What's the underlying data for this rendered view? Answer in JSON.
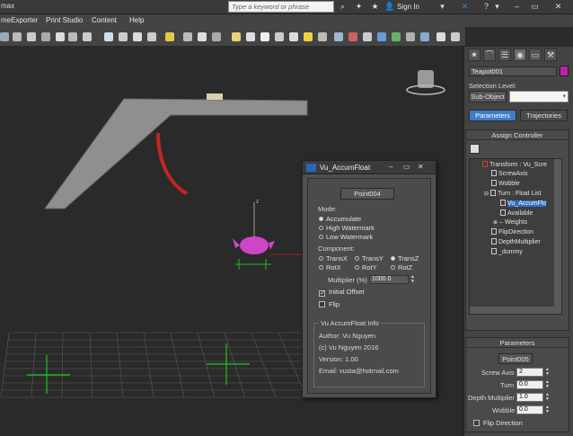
{
  "app": {
    "title_fragment": "max",
    "search_placeholder": "Type a keyword or phrase",
    "sign_in": "Sign In"
  },
  "menu": [
    "meExporter",
    "Print Studio",
    "Content",
    "Help"
  ],
  "command_panel": {
    "object_name": "Teapot001",
    "selection_level_label": "Selection Level:",
    "sub_object_label": "Sub-Object",
    "tabs": [
      "Parameters",
      "Trajectories"
    ],
    "assign_controller_title": "Assign Controller",
    "tree": [
      {
        "label": "Transform : Vu_Scre",
        "indent": 0
      },
      {
        "label": "ScrewAxis",
        "indent": 1
      },
      {
        "label": "Wobble",
        "indent": 1
      },
      {
        "label": "Turn : Float List",
        "indent": 1
      },
      {
        "label": "Vu_AccumFlo",
        "indent": 2,
        "selected": true
      },
      {
        "label": "Available",
        "indent": 2
      },
      {
        "label": "Weights",
        "indent": 2
      },
      {
        "label": "FlipDirection",
        "indent": 1
      },
      {
        "label": "DepthMultiplier",
        "indent": 1
      },
      {
        "label": "_dummy",
        "indent": 1
      }
    ],
    "parameters_title": "Parameters",
    "point_button": "Point005",
    "params": [
      {
        "label": "Screw Axis",
        "value": "2"
      },
      {
        "label": "Turn",
        "value": "0.0"
      },
      {
        "label": "Depth Multiplier",
        "value": "1.0"
      },
      {
        "label": "Wobble",
        "value": "0.0"
      }
    ],
    "flip_direction": "Flip Direction"
  },
  "dialog": {
    "title": "Vu_AccumFloat",
    "point_button": "Point004",
    "mode_label": "Mode:",
    "modes": [
      {
        "label": "Accumulate",
        "selected": true
      },
      {
        "label": "High Watermark",
        "selected": false
      },
      {
        "label": "Low Watermark",
        "selected": false
      }
    ],
    "component_label": "Component:",
    "components": [
      {
        "label": "TransX",
        "selected": false
      },
      {
        "label": "TransY",
        "selected": false
      },
      {
        "label": "TransZ",
        "selected": true
      },
      {
        "label": "RotX",
        "selected": false
      },
      {
        "label": "RotY",
        "selected": false
      },
      {
        "label": "RotZ",
        "selected": false
      }
    ],
    "multiplier_label": "Multiplier (%)",
    "multiplier_value": "1000.0",
    "initial_offset": "Initial Offset",
    "initial_offset_checked": true,
    "flip": "Flip",
    "flip_checked": false,
    "info_title": "Vu AccumFloat Info",
    "info_lines": [
      "Author: Vu Nguyen",
      "(c) Vu Nguyen 2016",
      "Version: 1.00",
      "Email: vusta@hotmail.com"
    ]
  },
  "viewport": {
    "axis_label": "z"
  }
}
